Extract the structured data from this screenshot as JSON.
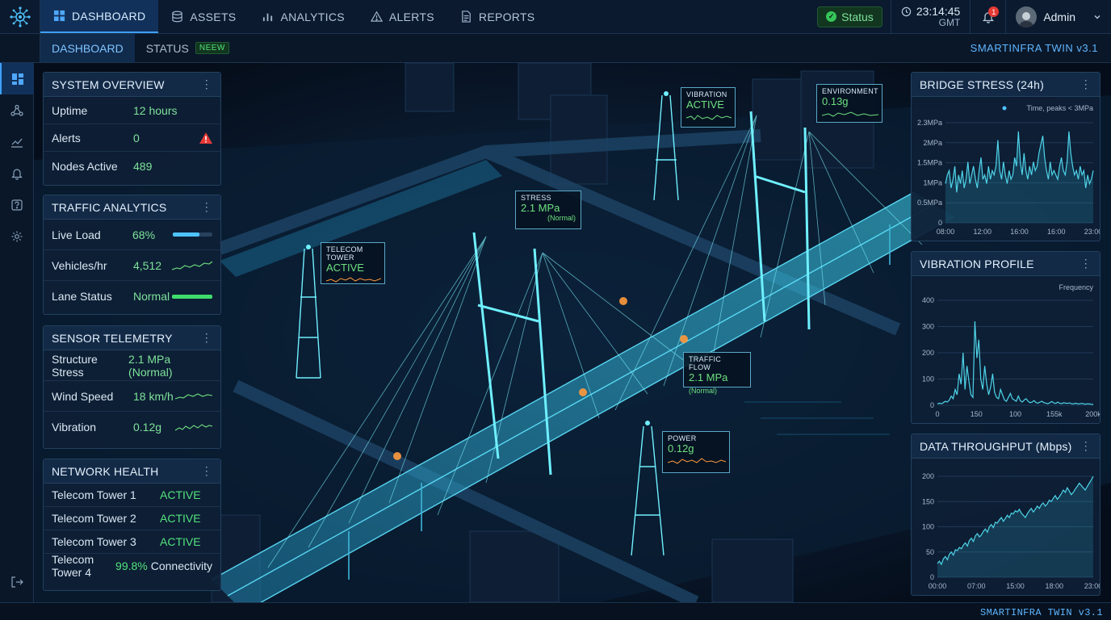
{
  "nav": {
    "items": [
      {
        "label": "DASHBOARD"
      },
      {
        "label": "ASSETS"
      },
      {
        "label": "ANALYTICS"
      },
      {
        "label": "ALERTS"
      },
      {
        "label": "REPORTS"
      }
    ],
    "status_label": "Status",
    "clock_time": "23:14:45",
    "clock_zone": "GMT",
    "notification_count": "1",
    "user_name": "Admin"
  },
  "subnav": {
    "tabs": [
      {
        "label": "DASHBOARD"
      },
      {
        "label": "STATUS"
      }
    ],
    "new_badge": "NEEW",
    "brand": "SMARTINFRA TWIN v3.1"
  },
  "system_overview": {
    "title": "SYSTEM OVERVIEW",
    "rows": [
      {
        "label": "Uptime",
        "value": "12 hours"
      },
      {
        "label": "Alerts",
        "value": "0"
      },
      {
        "label": "Nodes Active",
        "value": "489"
      }
    ]
  },
  "traffic_analytics": {
    "title": "TRAFFIC ANALYTICS",
    "rows": [
      {
        "label": "Live Load",
        "value": "68%",
        "progress": 0.68
      },
      {
        "label": "Vehicles/hr",
        "value": "4,512"
      },
      {
        "label": "Lane Status",
        "value": "Normal",
        "progress": 1.0
      }
    ]
  },
  "sensor_telemetry": {
    "title": "SENSOR TELEMETRY",
    "rows": [
      {
        "label": "Structure Stress",
        "value": "2.1 MPa (Normal)"
      },
      {
        "label": "Wind Speed",
        "value": "18 km/h"
      },
      {
        "label": "Vibration",
        "value": "0.12g"
      }
    ]
  },
  "network_health": {
    "title": "NETWORK HEALTH",
    "rows": [
      {
        "label": "Telecom Tower 1",
        "value": "ACTIVE"
      },
      {
        "label": "Telecom Tower 2",
        "value": "ACTIVE"
      },
      {
        "label": "Telecom Tower 3",
        "value": "ACTIVE"
      },
      {
        "label": "Telecom Tower 4",
        "value": "99.8%",
        "suffix": "Connectivity"
      }
    ]
  },
  "scene_labels": {
    "telecom": {
      "title": "TELECOM TOWER",
      "value": "ACTIVE"
    },
    "stress": {
      "title": "STRESS",
      "value": "2.1 MPa",
      "sub": "(Normal)"
    },
    "vibration": {
      "title": "VIBRATION",
      "value": "ACTIVE"
    },
    "environment": {
      "title": "ENVIRONMENT",
      "value": "0.13g"
    },
    "traffic": {
      "title": "TRAFFIC FLOW",
      "value": "2.1 MPa",
      "sub": "(Normal)"
    },
    "power": {
      "title": "POWER",
      "value": "0.12g"
    }
  },
  "chart_data": [
    {
      "type": "area",
      "title": "BRIDGE STRESS (24h)",
      "legend": "Time, peaks < 3MPa",
      "x_ticks": [
        "08:00",
        "12:00",
        "16:00",
        "16:00",
        "23:00"
      ],
      "y_ticks": [
        "0",
        "0.5MPa",
        "1MPa",
        "1.5MPa",
        "2MPa",
        "2.3MPa"
      ],
      "ylim": [
        0,
        2.3
      ],
      "values": [
        0.9,
        1.1,
        1.2,
        0.8,
        1.0,
        1.3,
        0.7,
        1.1,
        0.9,
        1.2,
        0.8,
        1.0,
        1.4,
        0.9,
        1.1,
        1.3,
        1.0,
        0.8,
        1.2,
        1.5,
        1.0,
        1.1,
        0.9,
        1.3,
        1.0,
        1.2,
        1.1,
        1.3,
        1.9,
        1.2,
        1.0,
        1.4,
        1.1,
        0.9,
        1.2,
        1.0,
        1.1,
        1.5,
        1.3,
        2.1,
        1.4,
        1.1,
        1.6,
        1.2,
        1.0,
        1.3,
        1.1,
        1.4,
        1.2,
        1.3,
        1.6,
        1.8,
        2.0,
        1.5,
        1.2,
        1.0,
        1.4,
        1.1,
        1.2,
        1.1,
        1.0,
        1.3,
        1.5,
        1.2,
        1.1,
        1.4,
        2.1,
        1.6,
        1.3,
        1.1,
        1.2,
        1.0,
        1.3,
        1.1,
        1.2,
        0.8,
        1.1,
        0.9,
        1.0,
        1.2
      ]
    },
    {
      "type": "line",
      "title": "VIBRATION PROFILE",
      "legend": "Frequency",
      "x_ticks": [
        "0",
        "150",
        "100",
        "155k",
        "200k"
      ],
      "y_ticks": [
        "0",
        "100",
        "200",
        "300",
        "400"
      ],
      "ylim": [
        0,
        400
      ],
      "values": [
        5,
        8,
        6,
        10,
        15,
        12,
        20,
        35,
        25,
        60,
        40,
        120,
        80,
        200,
        60,
        150,
        90,
        40,
        30,
        320,
        180,
        250,
        100,
        60,
        150,
        80,
        40,
        70,
        120,
        50,
        30,
        25,
        60,
        40,
        20,
        15,
        30,
        45,
        25,
        20,
        15,
        35,
        18,
        12,
        20,
        25,
        15,
        10,
        12,
        18,
        10,
        8,
        12,
        15,
        10,
        8,
        6,
        10,
        14,
        9,
        7,
        12,
        8,
        6,
        10,
        8,
        7,
        9,
        6,
        5,
        8,
        6,
        5,
        7,
        6,
        4,
        6,
        5,
        4,
        3
      ]
    },
    {
      "type": "area",
      "title": "DATA THROUGHPUT (Mbps)",
      "x_ticks": [
        "00:00",
        "07:00",
        "15:00",
        "18:00",
        "23:00"
      ],
      "y_ticks": [
        "0",
        "50",
        "100",
        "150",
        "200"
      ],
      "ylim": [
        0,
        220
      ],
      "values": [
        30,
        35,
        28,
        40,
        45,
        38,
        50,
        55,
        48,
        60,
        58,
        65,
        62,
        70,
        75,
        68,
        80,
        85,
        78,
        90,
        95,
        88,
        92,
        100,
        105,
        98,
        110,
        115,
        108,
        120,
        118,
        125,
        130,
        122,
        128,
        135,
        130,
        140,
        138,
        145,
        142,
        148,
        140,
        135,
        130,
        138,
        145,
        150,
        142,
        148,
        155,
        150,
        158,
        162,
        155,
        160,
        168,
        165,
        172,
        178,
        170,
        175,
        182,
        190,
        185,
        195,
        188,
        180,
        185,
        192,
        198,
        205,
        200,
        195,
        190,
        198,
        205,
        212,
        220
      ]
    }
  ],
  "footer": {
    "brand": "SMARTINFRA TWIN v3.1"
  }
}
